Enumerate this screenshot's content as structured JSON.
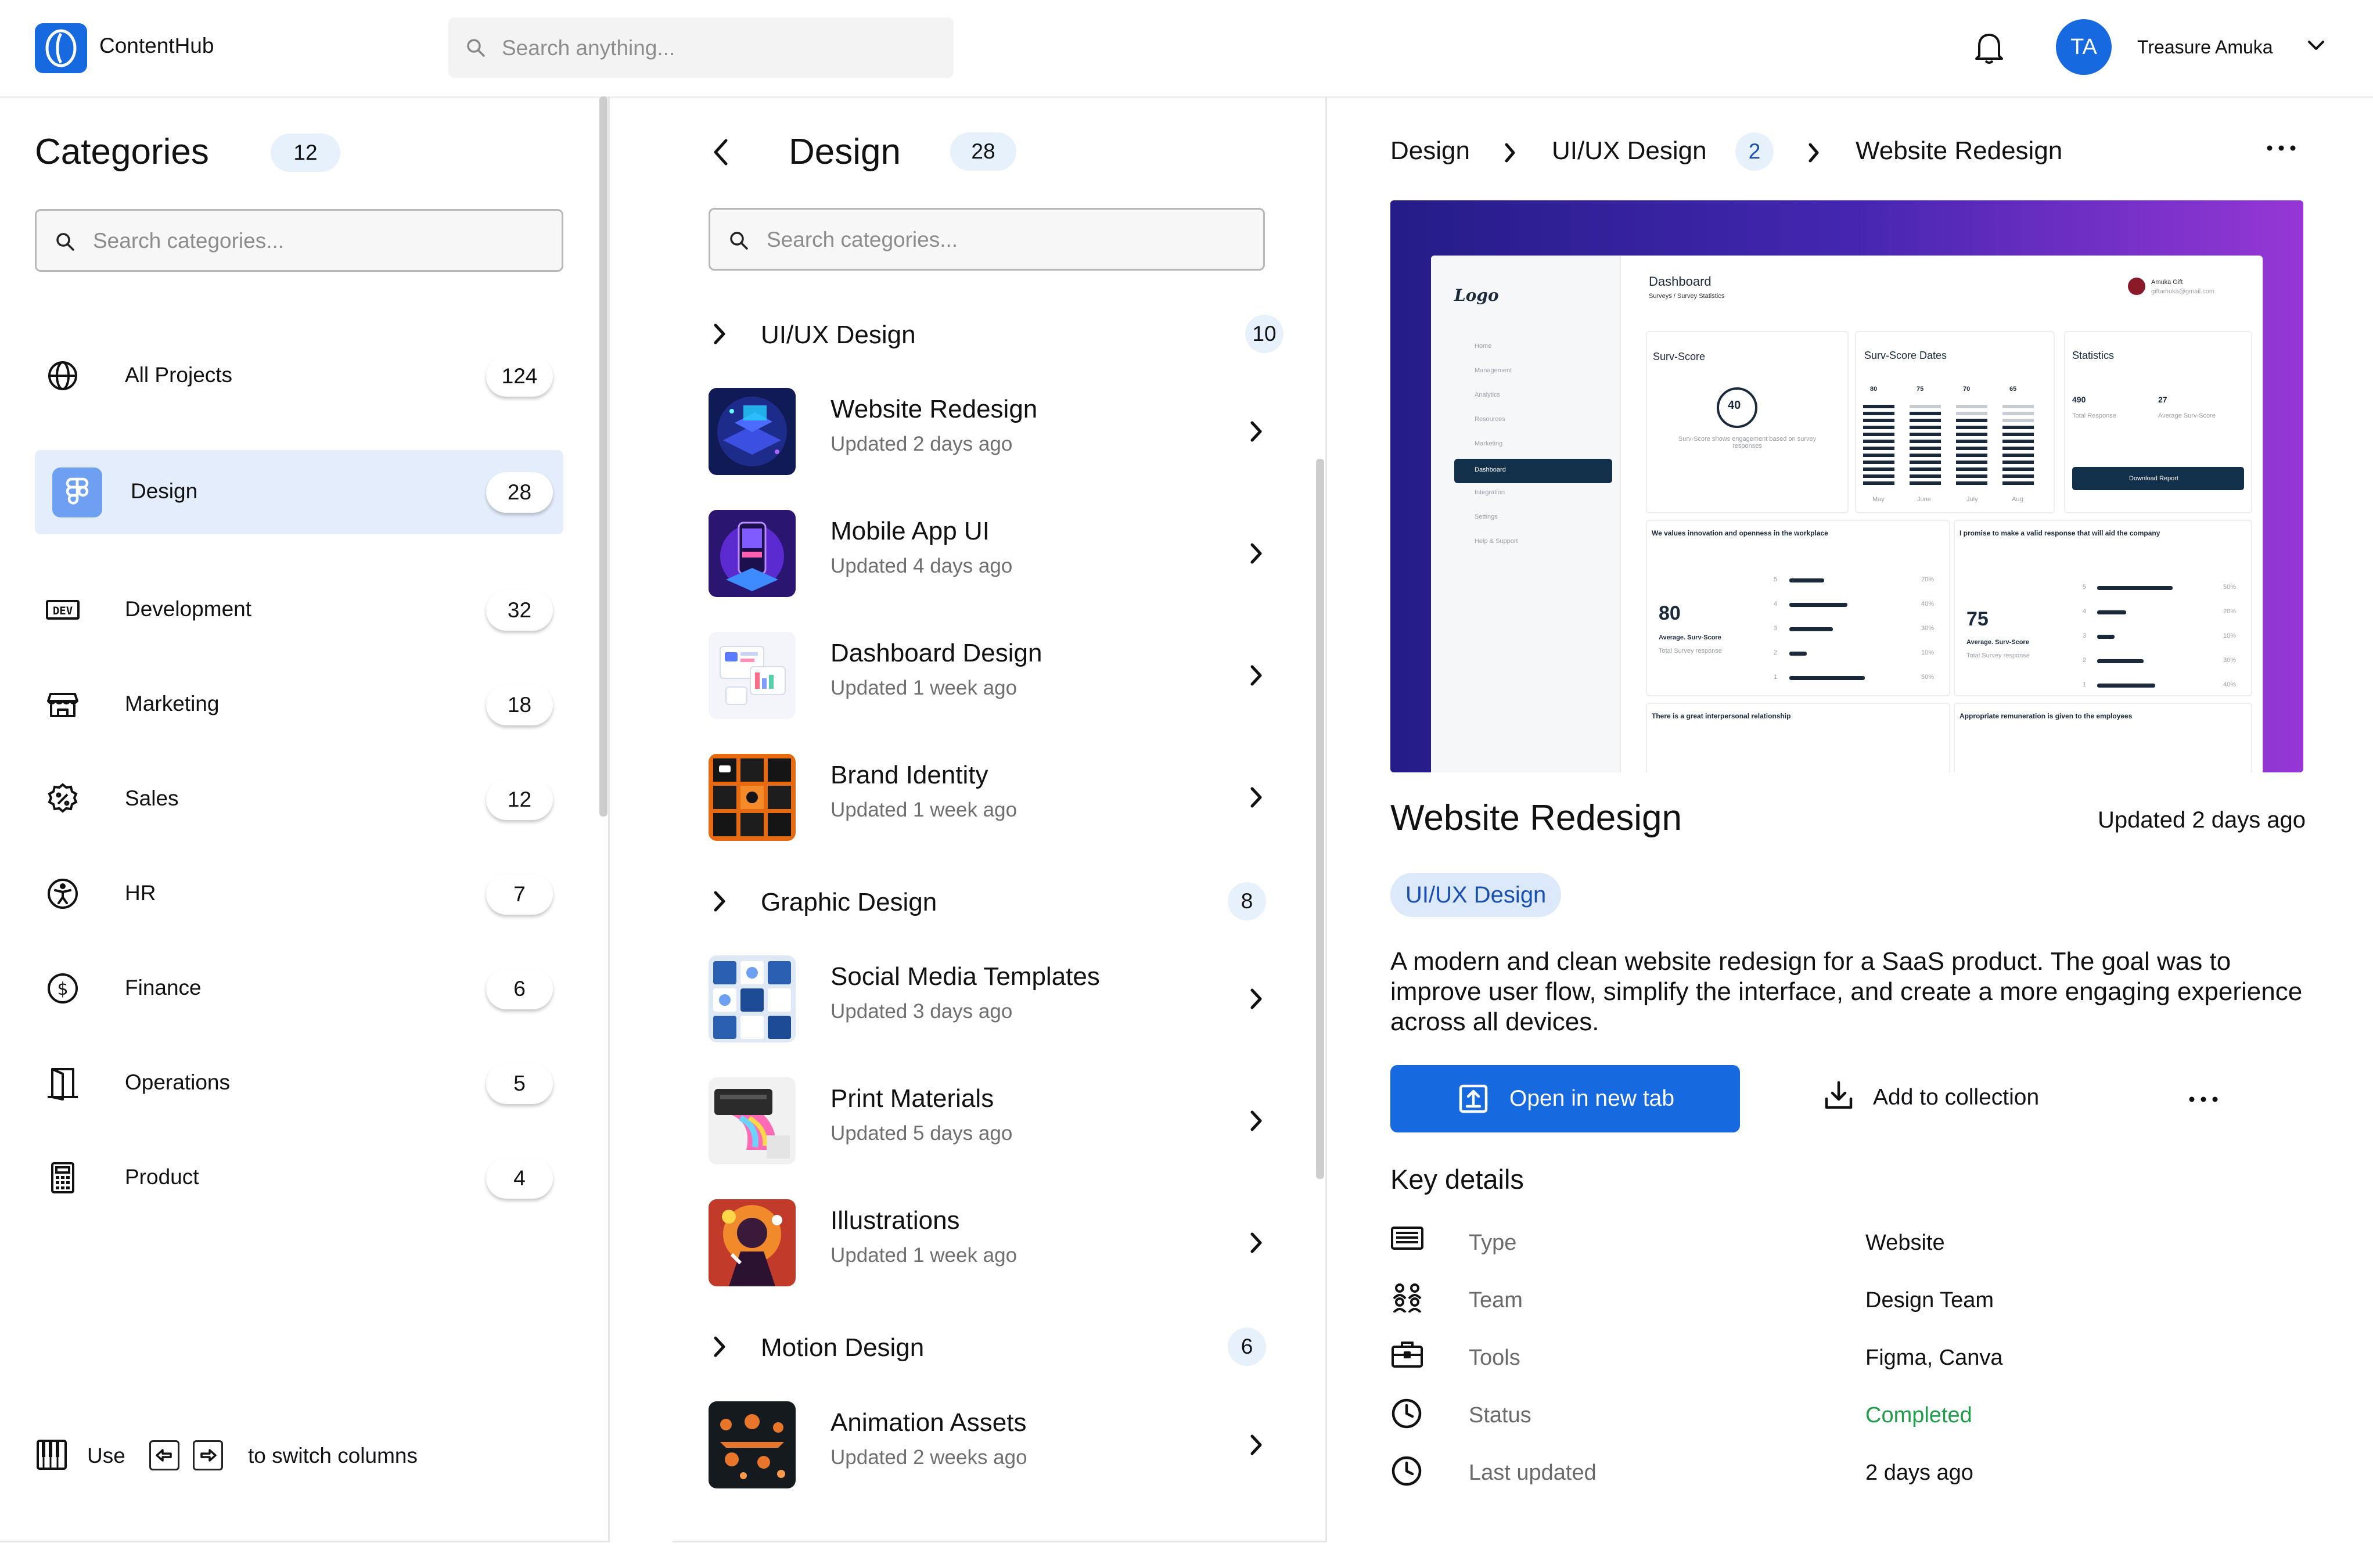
{
  "app": {
    "title": "ContentHub"
  },
  "search": {
    "placeholder": "Search anything..."
  },
  "user": {
    "initials": "TA",
    "name": "Treasure Amuka"
  },
  "categories": {
    "title": "Categories",
    "count": "12",
    "search_placeholder": "Search categories...",
    "items": [
      {
        "label": "All Projects",
        "count": "124",
        "icon": "globe-icon"
      },
      {
        "label": "Design",
        "count": "28",
        "icon": "figma-icon",
        "active": true
      },
      {
        "label": "Development",
        "count": "32",
        "icon": "dev-icon"
      },
      {
        "label": "Marketing",
        "count": "18",
        "icon": "storefront-icon"
      },
      {
        "label": "Sales",
        "count": "12",
        "icon": "discount-badge-icon"
      },
      {
        "label": "HR",
        "count": "7",
        "icon": "accessibility-icon"
      },
      {
        "label": "Finance",
        "count": "6",
        "icon": "dollar-circle-icon"
      },
      {
        "label": "Operations",
        "count": "5",
        "icon": "door-icon"
      },
      {
        "label": "Product",
        "count": "4",
        "icon": "calculator-icon"
      }
    ],
    "footer": {
      "use": "Use",
      "hint": "to switch columns"
    }
  },
  "design": {
    "title": "Design",
    "count": "28",
    "search_placeholder": "Search categories...",
    "groups": [
      {
        "label": "UI/UX Design",
        "count": "10",
        "items": [
          {
            "title": "Website Redesign",
            "updated": "Updated 2 days ago"
          },
          {
            "title": "Mobile App UI",
            "updated": "Updated 4 days ago"
          },
          {
            "title": "Dashboard Design",
            "updated": "Updated 1 week ago"
          },
          {
            "title": "Brand Identity",
            "updated": "Updated 1 week ago"
          }
        ]
      },
      {
        "label": "Graphic Design",
        "count": "8",
        "items": [
          {
            "title": "Social Media Templates",
            "updated": "Updated 3 days ago"
          },
          {
            "title": "Print Materials",
            "updated": "Updated 5 days ago"
          },
          {
            "title": "Illustrations",
            "updated": "Updated 1 week ago"
          }
        ]
      },
      {
        "label": "Motion Design",
        "count": "6",
        "items": [
          {
            "title": "Animation Assets",
            "updated": "Updated 2 weeks ago"
          }
        ]
      }
    ]
  },
  "detail": {
    "breadcrumb": [
      "Design",
      "UI/UX Design",
      "Website Redesign"
    ],
    "breadcrumb_badge": "2",
    "title": "Website Redesign",
    "updated": "Updated 2 days ago",
    "tag": "UI/UX Design",
    "description": "A modern and clean website redesign for a SaaS product. The goal was to improve user flow, simplify the interface, and create a more engaging experience across all devices.",
    "open_label": "Open in new tab",
    "collection_label": "Add to collection",
    "key_details_title": "Key details",
    "key_details": [
      {
        "label": "Type",
        "value": "Website",
        "icon": "keyboard-icon"
      },
      {
        "label": "Team",
        "value": "Design Team",
        "icon": "team-icon"
      },
      {
        "label": "Tools",
        "value": "Figma, Canva",
        "icon": "briefcase-icon"
      },
      {
        "label": "Status",
        "value": "Completed",
        "icon": "clock-icon",
        "color": "#1f9d4c"
      },
      {
        "label": "Last updated",
        "value": "2 days ago",
        "icon": "clock-icon"
      }
    ],
    "preview": {
      "logo": "Logo",
      "title": "Dashboard",
      "crumb": "Surveys / Survey Statistics",
      "user_name": "Amuka Gift",
      "user_email": "giftamuka@gmail.com",
      "nav": [
        "Home",
        "Management",
        "Analytics",
        "Resources",
        "Marketing",
        "Dashboard",
        "Integration",
        "Settings",
        "Help & Support"
      ],
      "card1_title": "Surv-Score",
      "card1_value": "40",
      "card1_note": "Surv-Score shows engagement based on survey responses",
      "card2_title": "Surv-Score Dates",
      "card2_values": [
        "80",
        "75",
        "70",
        "65"
      ],
      "card2_months": [
        "May",
        "June",
        "July",
        "Aug"
      ],
      "card3_title": "Statistics",
      "card3_left_value": "490",
      "card3_left_label": "Total Response",
      "card3_right_value": "27",
      "card3_right_label": "Average Surv-Score",
      "card3_button": "Download Report",
      "q1": "We values innovation and openness in the workplace",
      "q1_value": "80",
      "q2": "I promise to make a valid response that will aid the company",
      "q2_value": "75",
      "avg_label": "Average. Surv-Score",
      "total_label": "Total Survey response",
      "q3": "There is a great interpersonal relationship",
      "q4": "Appropriate remuneration is given to the employees",
      "q1_scale": [
        "5",
        "4",
        "3",
        "2",
        "1"
      ],
      "q1_percent": [
        "20%",
        "40%",
        "30%",
        "10%",
        "50%"
      ],
      "q2_percent": [
        "50%",
        "20%",
        "10%",
        "30%",
        "40%"
      ]
    }
  }
}
